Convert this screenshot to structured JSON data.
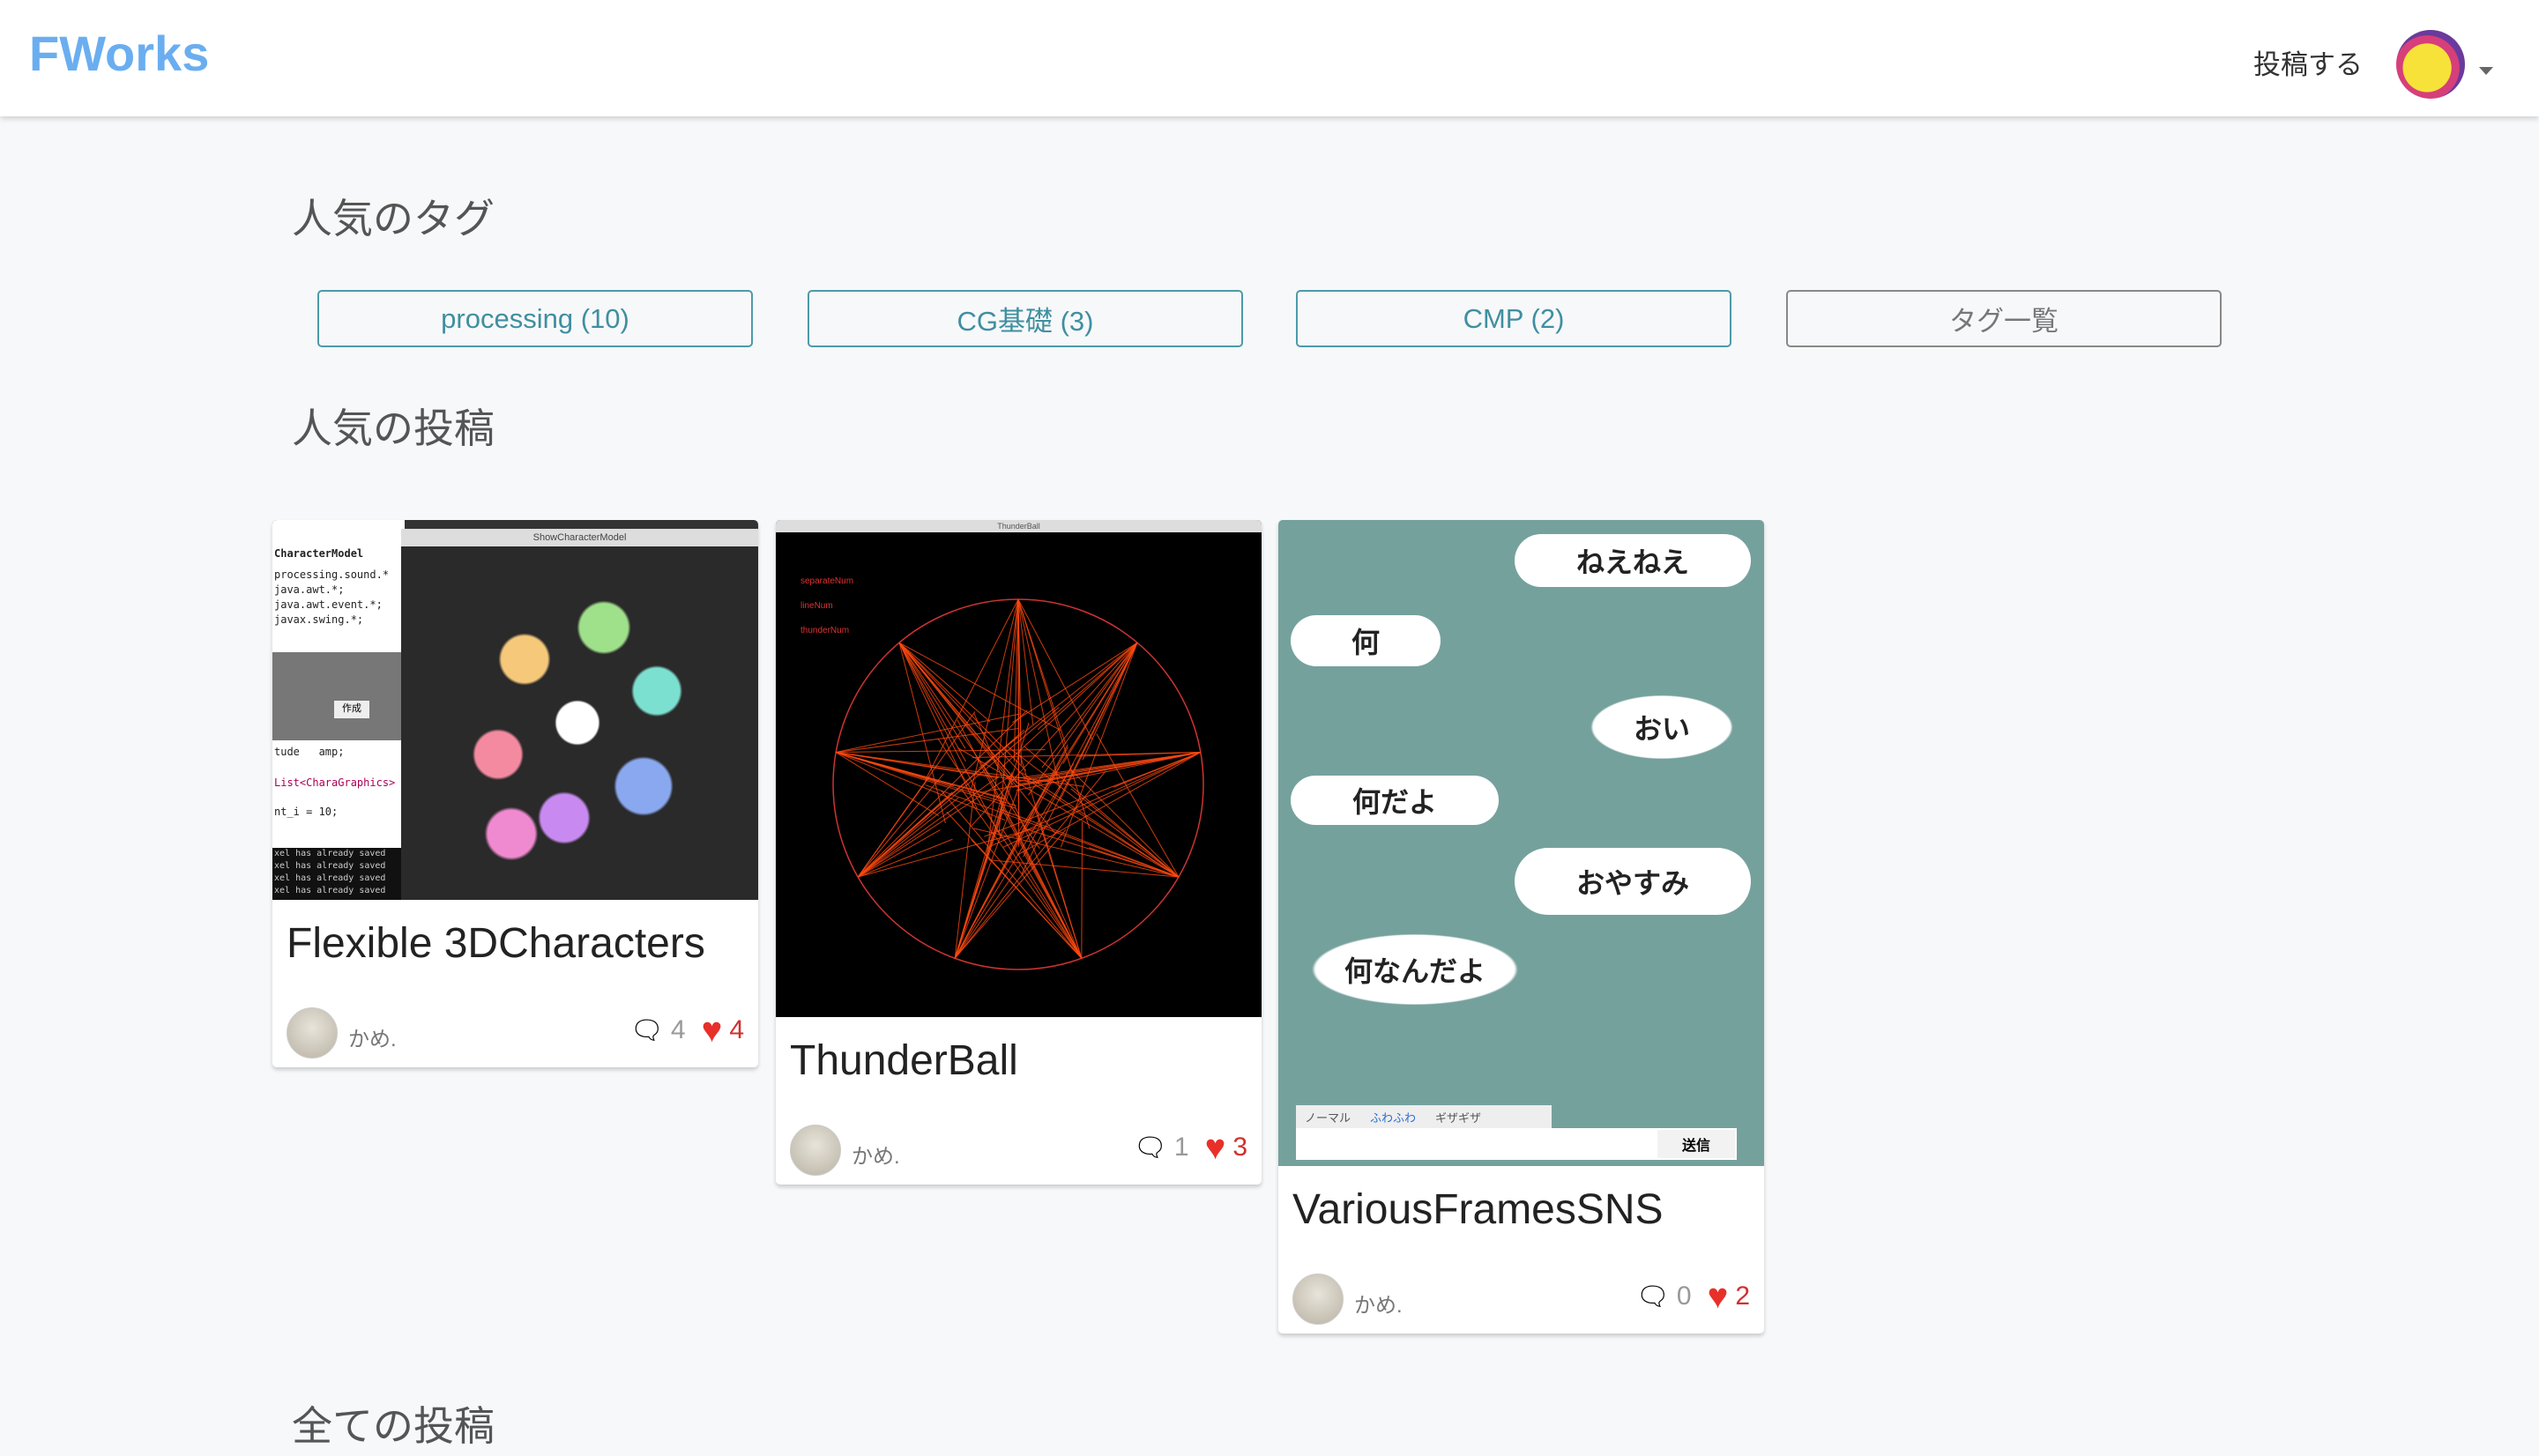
{
  "header": {
    "logo": "FWorks",
    "post_label": "投稿する"
  },
  "popular_tags": {
    "heading": "人気のタグ",
    "tags": [
      "processing (10)",
      "CG基礎 (3)",
      "CMP (2)"
    ],
    "all_tags_label": "タグ一覧"
  },
  "popular_posts": {
    "heading": "人気の投稿",
    "posts": [
      {
        "title": "Flexible 3DCharacters",
        "author": "かめ.",
        "comments": "4",
        "likes": "4",
        "thumb": {
          "window_title": "ShowCharacterModel",
          "tab": "CharacterModel",
          "code": [
            "processing.sound.*",
            "java.awt.*;",
            "java.awt.event.*;",
            "javax.swing.*;",
            "tude   amp;",
            "List<CharaGraphics>",
            "nt_i = 10;"
          ],
          "console": [
            "xel has already saved",
            "xel has already saved",
            "xel has already saved",
            "xel has already saved"
          ],
          "button": "作成"
        }
      },
      {
        "title": "ThunderBall",
        "author": "かめ.",
        "comments": "1",
        "likes": "3",
        "thumb": {
          "window_title": "ThunderBall",
          "controls": [
            "separateNum",
            "lineNum",
            "thunderNum"
          ]
        }
      },
      {
        "title": "VariousFramesSNS",
        "author": "かめ.",
        "comments": "0",
        "likes": "2",
        "thumb": {
          "bubbles": [
            "ねえねえ",
            "何",
            "おい",
            "何だよ",
            "おやすみ",
            "何なんだよ"
          ],
          "radios": [
            "ノーマル",
            "ふわふわ",
            "ギザギザ"
          ],
          "send": "送信"
        }
      }
    ]
  },
  "all_posts": {
    "heading": "全ての投稿"
  },
  "colors": {
    "brand": "#6aaef0",
    "tag": "#3f8fa0",
    "like": "#e8302a",
    "sns_bg": "#75a19d"
  }
}
